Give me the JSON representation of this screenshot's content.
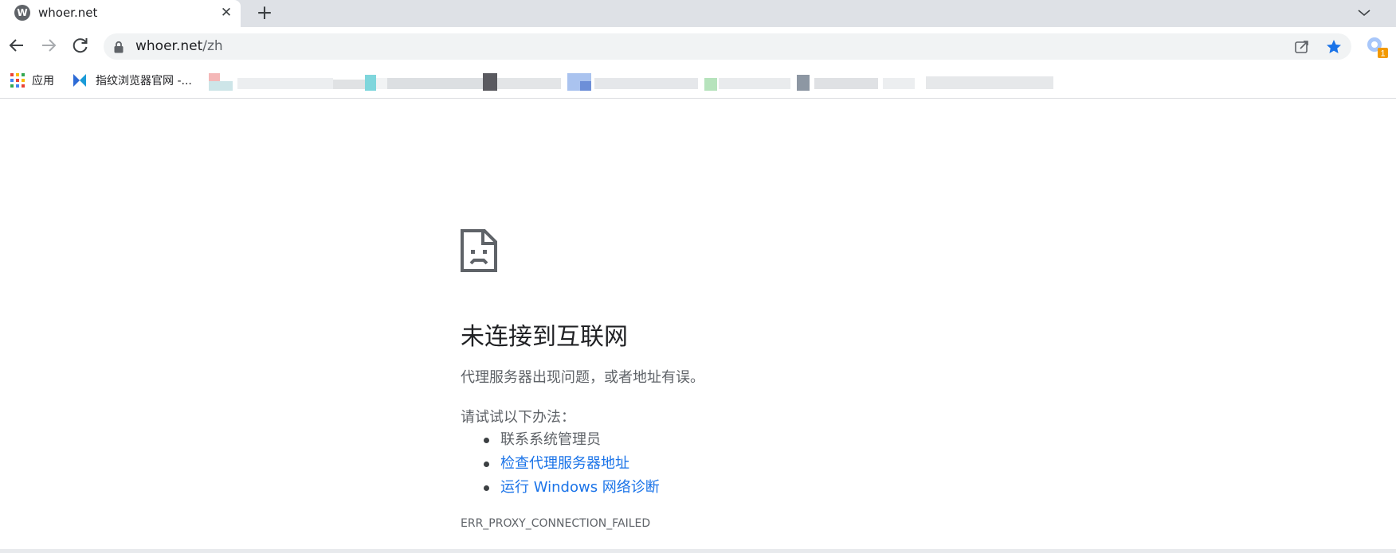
{
  "tab": {
    "favicon_letter": "W",
    "title": "whoer.net",
    "close": "✕",
    "new_tab": "+"
  },
  "toolbar": {
    "url_host": "whoer.net",
    "url_path": "/zh",
    "extension_badge": "1"
  },
  "bookmarks": {
    "apps_label": "应用",
    "item_1_label": "指纹浏览器官网 -..."
  },
  "error": {
    "title": "未连接到互联网",
    "description": "代理服务器出现问题，或者地址有误。",
    "try_label": "请试试以下办法：",
    "suggestions": [
      "联系系统管理员",
      "检查代理服务器地址",
      "运行 Windows 网络诊断"
    ],
    "code": "ERR_PROXY_CONNECTION_FAILED"
  },
  "colors": {
    "link": "#1a73e8",
    "star": "#1a73e8",
    "tabstrip": "#dee1e6",
    "omnibox": "#f1f3f4"
  },
  "icons": {
    "back": "arrow-left-icon",
    "forward": "arrow-right-icon",
    "reload": "reload-icon",
    "lock": "lock-icon",
    "share": "share-icon",
    "bookmark": "star-icon",
    "extension": "extension-icon",
    "error": "sad-page-icon"
  }
}
